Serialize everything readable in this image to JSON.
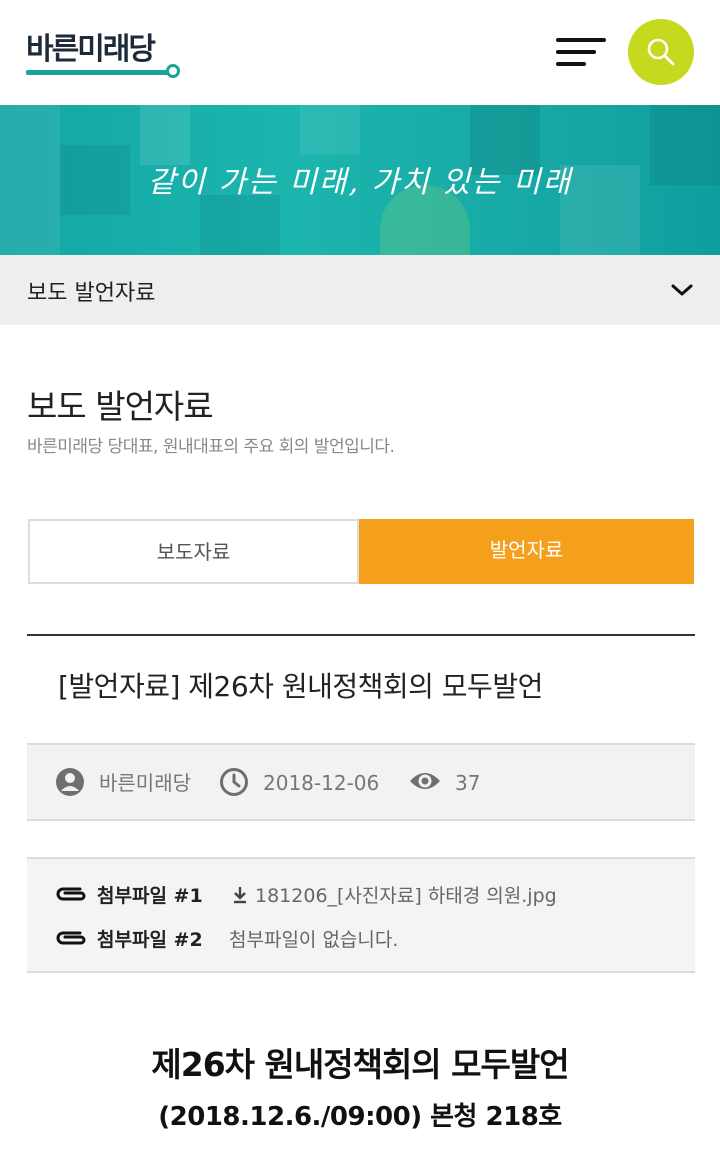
{
  "header": {
    "logo_text": "바른미래당",
    "menu_icon": "hamburger-menu-icon",
    "search_icon": "search-icon",
    "search_color": "#c5d91f",
    "brand_color": "#1aa39a"
  },
  "banner": {
    "slogan": "같이 가는 미래, 가치 있는 미래"
  },
  "section_select": {
    "value": "보도 발언자료",
    "icon": "chevron-down-icon"
  },
  "page": {
    "title": "보도 발언자료",
    "description": "바른미래당 당대표, 원내대표의 주요 회의 발언입니다."
  },
  "tabs": [
    {
      "label": "보도자료",
      "active": false
    },
    {
      "label": "발언자료",
      "active": true
    }
  ],
  "accent_color": "#f5a01d",
  "post": {
    "title": "[발언자료] 제26차 원내정책회의 모두발언",
    "author": "바른미래당",
    "date": "2018-12-06",
    "views": "37"
  },
  "attachments": [
    {
      "label": "첨부파일 #1",
      "file": "181206_[사진자료] 하태경 의원.jpg",
      "has_file": true
    },
    {
      "label": "첨부파일 #2",
      "file": "첨부파일이 없습니다.",
      "has_file": false
    }
  ],
  "content": {
    "title": "제26차 원내정책회의 모두발언",
    "subtitle": "(2018.12.6./09:00) 본청 218호"
  }
}
